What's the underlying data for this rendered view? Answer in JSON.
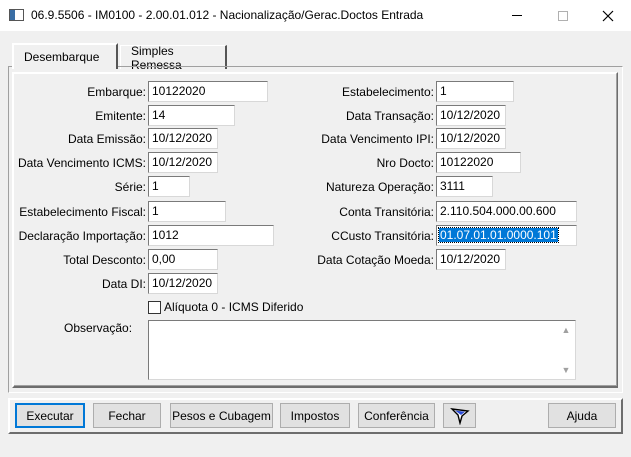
{
  "window": {
    "title": "06.9.5506 - IM0100 - 2.00.01.012 - Nacionalização/Gerac.Doctos Entrada"
  },
  "tabs": [
    {
      "label": "Desembarque",
      "active": true
    },
    {
      "label": "Simples Remessa",
      "active": false
    }
  ],
  "form": {
    "embarque": {
      "label": "Embarque:",
      "value": "10122020"
    },
    "emitente": {
      "label": "Emitente:",
      "value": "14"
    },
    "data_emissao": {
      "label": "Data Emissão:",
      "value": "10/12/2020"
    },
    "data_venc_icms": {
      "label": "Data Vencimento ICMS:",
      "value": "10/12/2020"
    },
    "serie": {
      "label": "Série:",
      "value": "1"
    },
    "estab_fiscal": {
      "label": "Estabelecimento Fiscal:",
      "value": "1"
    },
    "decl_importacao": {
      "label": "Declaração Importação:",
      "value": "1012"
    },
    "total_desconto": {
      "label": "Total Desconto:",
      "value": "0,00"
    },
    "data_di": {
      "label": "Data DI:",
      "value": "10/12/2020"
    },
    "estabelecimento": {
      "label": "Estabelecimento:",
      "value": "1"
    },
    "data_transacao": {
      "label": "Data Transação:",
      "value": "10/12/2020"
    },
    "data_venc_ipi": {
      "label": "Data Vencimento IPI:",
      "value": "10/12/2020"
    },
    "nro_docto": {
      "label": "Nro Docto:",
      "value": "10122020"
    },
    "natureza_operacao": {
      "label": "Natureza Operação:",
      "value": "3111"
    },
    "conta_transitoria": {
      "label": "Conta Transitória:",
      "value": "2.110.504.000.00.600"
    },
    "ccusto_transitoria": {
      "label": "CCusto Transitória:",
      "value": "01.07.01.01.0000.101"
    },
    "data_cotacao_moeda": {
      "label": "Data Cotação Moeda:",
      "value": "10/12/2020"
    },
    "aliquota_checkbox": {
      "label": "Alíquota 0 - ICMS Diferido",
      "checked": false
    },
    "observacao": {
      "label": "Observação:",
      "value": ""
    }
  },
  "buttons": {
    "executar": "Executar",
    "fechar": "Fechar",
    "pesos": "Pesos e Cubagem",
    "impostos": "Impostos",
    "conferencia": "Conferência",
    "ajuda": "Ajuda"
  },
  "icons": {
    "filter": "filter-funnel-icon",
    "accent_color": "#0078d7"
  }
}
